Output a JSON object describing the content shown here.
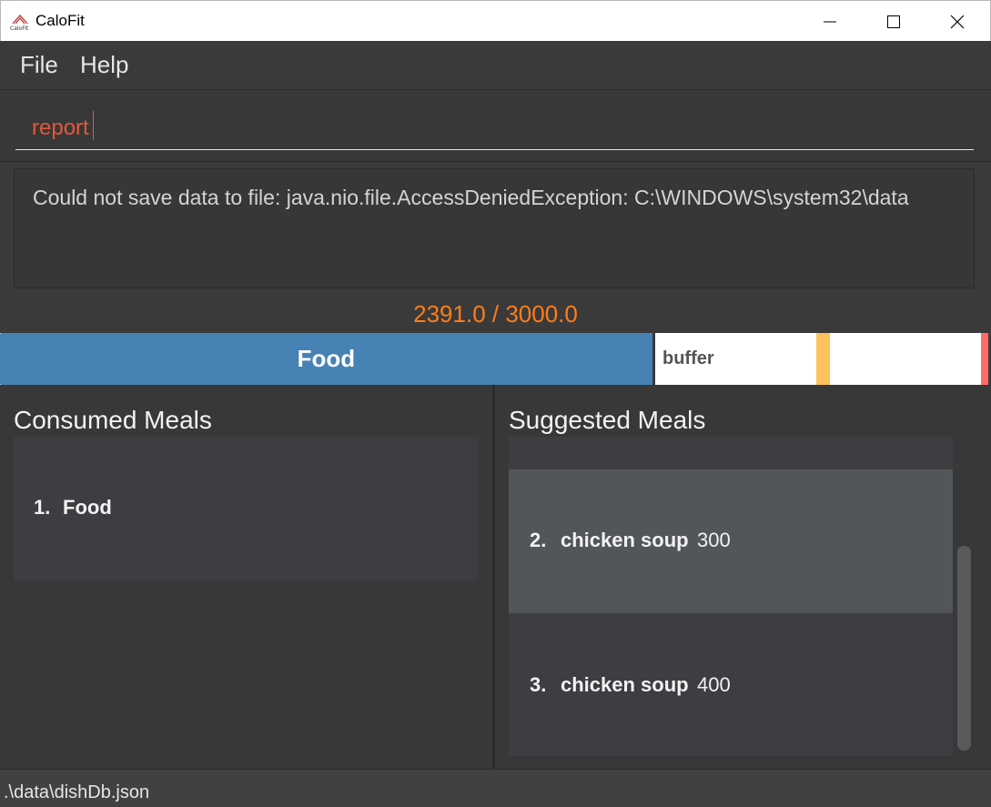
{
  "window": {
    "title": "CaloFit",
    "icon": "calofit-logo-icon"
  },
  "menu": {
    "items": [
      "File",
      "Help"
    ]
  },
  "command": {
    "value": "report",
    "text_color": "#e2583a"
  },
  "result": {
    "message": "Could not save data to file: java.nio.file.AccessDeniedException: C:\\WINDOWS\\system32\\data"
  },
  "progress": {
    "label": "2391.0 / 3000.0",
    "consumed": 2391.0,
    "target": 3000.0,
    "fill_fraction": 0.66,
    "fill_label": "Food",
    "buffer_label": "buffer",
    "label_color": "#ff7d1a",
    "fill_color": "#4682b4",
    "marker_colors": [
      "#ffc35c",
      "#ff6a6a"
    ]
  },
  "consumed_meals": {
    "title": "Consumed Meals",
    "items": [
      {
        "index": "1.",
        "name": "Food"
      }
    ]
  },
  "suggested_meals": {
    "title": "Suggested Meals",
    "items": [
      {
        "index": "2.",
        "name": "chicken soup",
        "calories": "300",
        "selected": true
      },
      {
        "index": "3.",
        "name": "chicken soup",
        "calories": "400",
        "selected": false
      }
    ]
  },
  "status": {
    "path": ".\\data\\dishDb.json"
  }
}
